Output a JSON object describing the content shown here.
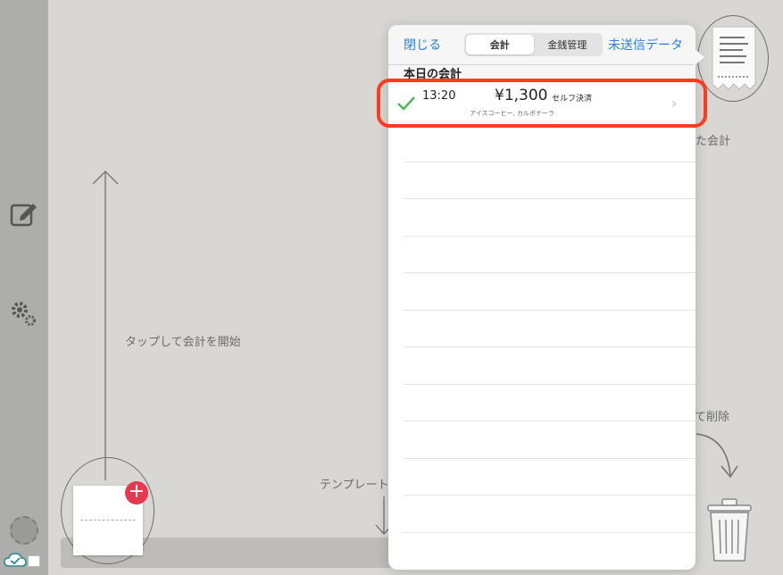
{
  "sidebar": {
    "icons": [
      "compose-icon",
      "settings-icon",
      "cloud-sync-icon"
    ]
  },
  "hints": {
    "tap_to_start": "タップして会計を開始",
    "template": "テンプレート",
    "delete": "て削除",
    "receipt_label": "た会計"
  },
  "popover": {
    "close_label": "閉じる",
    "segments": [
      "会計",
      "金銭管理"
    ],
    "active_segment": "会計",
    "unsent_label": "未送信データ",
    "section_title": "本日の会計",
    "transactions": [
      {
        "time": "13:20",
        "amount": "¥1,300",
        "type": "セルフ決済",
        "items": "アイスコーヒー, カルボナーラ",
        "status": "completed"
      }
    ]
  },
  "colors": {
    "accent": "#2a7fd3",
    "highlight": "#ff3b1f",
    "check": "#4cb85c",
    "badge": "#e8384f"
  }
}
